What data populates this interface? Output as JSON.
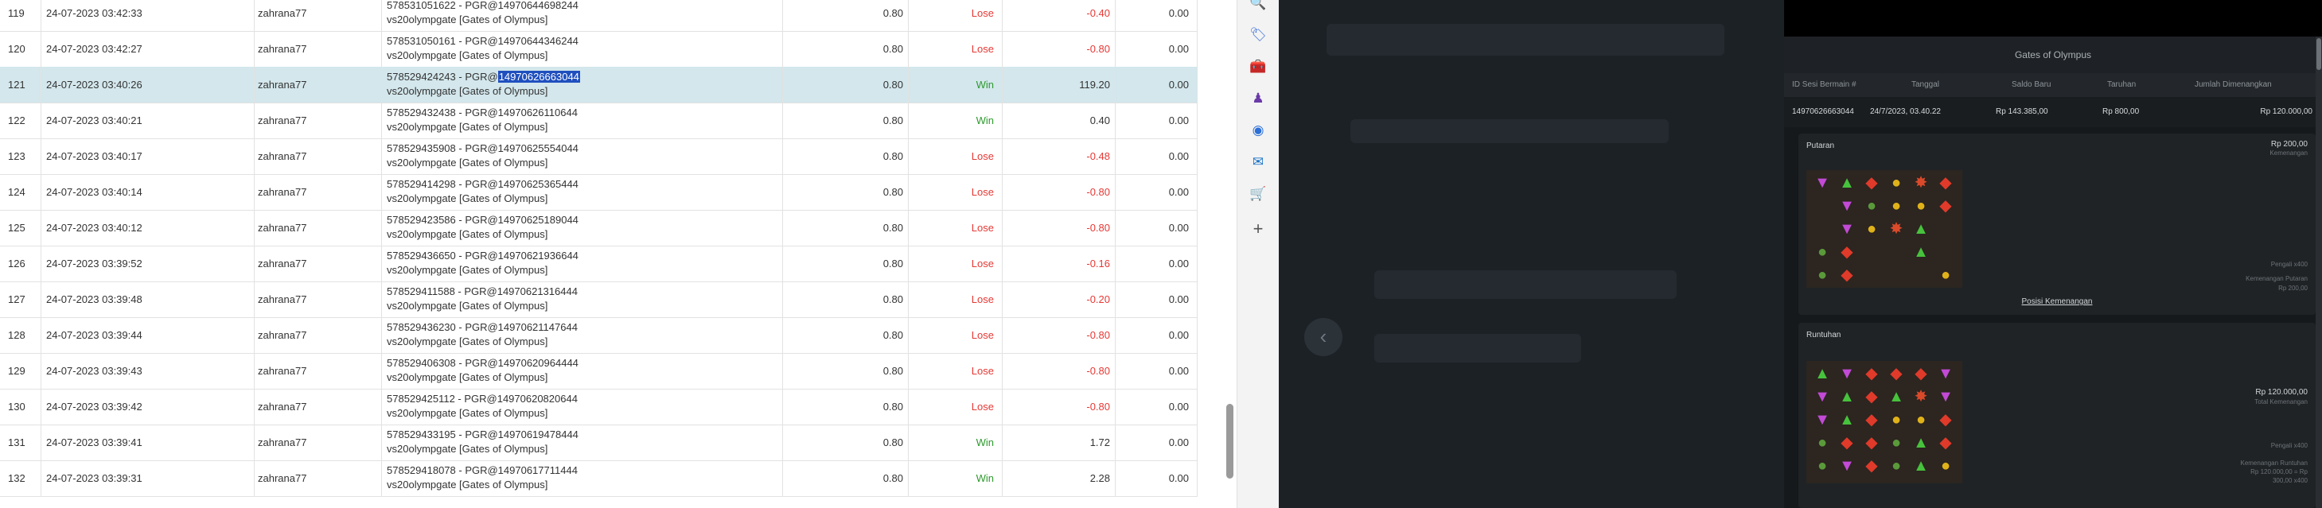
{
  "table": {
    "rows": [
      {
        "num": "119",
        "date": "24-07-2023 03:42:33",
        "user": "zahrana77",
        "id": "578531051622 - PGR@14970644698244",
        "game": "vs20olympgate [Gates of Olympus]",
        "bet": "0.80",
        "result": "Lose",
        "win": "-0.40",
        "jackpot": "0.00"
      },
      {
        "num": "120",
        "date": "24-07-2023 03:42:27",
        "user": "zahrana77",
        "id": "578531050161 - PGR@14970644346244",
        "game": "vs20olympgate [Gates of Olympus]",
        "bet": "0.80",
        "result": "Lose",
        "win": "-0.80",
        "jackpot": "0.00"
      },
      {
        "num": "121",
        "date": "24-07-2023 03:40:26",
        "user": "zahrana77",
        "id_prefix": "578529424243 - PGR@",
        "id_highlight": "14970626663044",
        "game": "vs20olympgate [Gates of Olympus]",
        "bet": "0.80",
        "result": "Win",
        "win": "119.20",
        "jackpot": "0.00",
        "selected": true
      },
      {
        "num": "122",
        "date": "24-07-2023 03:40:21",
        "user": "zahrana77",
        "id": "578529432438 - PGR@14970626110644",
        "game": "vs20olympgate [Gates of Olympus]",
        "bet": "0.80",
        "result": "Win",
        "win": "0.40",
        "jackpot": "0.00"
      },
      {
        "num": "123",
        "date": "24-07-2023 03:40:17",
        "user": "zahrana77",
        "id": "578529435908 - PGR@14970625554044",
        "game": "vs20olympgate [Gates of Olympus]",
        "bet": "0.80",
        "result": "Lose",
        "win": "-0.48",
        "jackpot": "0.00"
      },
      {
        "num": "124",
        "date": "24-07-2023 03:40:14",
        "user": "zahrana77",
        "id": "578529414298 - PGR@14970625365444",
        "game": "vs20olympgate [Gates of Olympus]",
        "bet": "0.80",
        "result": "Lose",
        "win": "-0.80",
        "jackpot": "0.00"
      },
      {
        "num": "125",
        "date": "24-07-2023 03:40:12",
        "user": "zahrana77",
        "id": "578529423586 - PGR@14970625189044",
        "game": "vs20olympgate [Gates of Olympus]",
        "bet": "0.80",
        "result": "Lose",
        "win": "-0.80",
        "jackpot": "0.00"
      },
      {
        "num": "126",
        "date": "24-07-2023 03:39:52",
        "user": "zahrana77",
        "id": "578529436650 - PGR@14970621936644",
        "game": "vs20olympgate [Gates of Olympus]",
        "bet": "0.80",
        "result": "Lose",
        "win": "-0.16",
        "jackpot": "0.00"
      },
      {
        "num": "127",
        "date": "24-07-2023 03:39:48",
        "user": "zahrana77",
        "id": "578529411588 - PGR@14970621316444",
        "game": "vs20olympgate [Gates of Olympus]",
        "bet": "0.80",
        "result": "Lose",
        "win": "-0.20",
        "jackpot": "0.00"
      },
      {
        "num": "128",
        "date": "24-07-2023 03:39:44",
        "user": "zahrana77",
        "id": "578529436230 - PGR@14970621147644",
        "game": "vs20olympgate [Gates of Olympus]",
        "bet": "0.80",
        "result": "Lose",
        "win": "-0.80",
        "jackpot": "0.00"
      },
      {
        "num": "129",
        "date": "24-07-2023 03:39:43",
        "user": "zahrana77",
        "id": "578529406308 - PGR@14970620964444",
        "game": "vs20olympgate [Gates of Olympus]",
        "bet": "0.80",
        "result": "Lose",
        "win": "-0.80",
        "jackpot": "0.00"
      },
      {
        "num": "130",
        "date": "24-07-2023 03:39:42",
        "user": "zahrana77",
        "id": "578529425112 - PGR@14970620820644",
        "game": "vs20olympgate [Gates of Olympus]",
        "bet": "0.80",
        "result": "Lose",
        "win": "-0.80",
        "jackpot": "0.00"
      },
      {
        "num": "131",
        "date": "24-07-2023 03:39:41",
        "user": "zahrana77",
        "id": "578529433195 - PGR@14970619478444",
        "game": "vs20olympgate [Gates of Olympus]",
        "bet": "0.80",
        "result": "Win",
        "win": "1.72",
        "jackpot": "0.00"
      },
      {
        "num": "132",
        "date": "24-07-2023 03:39:31",
        "user": "zahrana77",
        "id": "578529418078 - PGR@14970617711444",
        "game": "vs20olympgate [Gates of Olympus]",
        "bet": "0.80",
        "result": "Win",
        "win": "2.28",
        "jackpot": "0.00"
      }
    ]
  },
  "side_icons": [
    "search-icon",
    "tag-icon",
    "toolbox-icon",
    "chess-icon",
    "chrome-icon",
    "outlook-icon",
    "shopping-icon",
    "plus-icon"
  ],
  "popup": {
    "title": "Gates of Olympus",
    "headers": {
      "id": "ID Sesi Bermain #",
      "date": "Tanggal",
      "balance": "Saldo Baru",
      "bet": "Taruhan",
      "win": "Jumlah Dimenangkan"
    },
    "values": {
      "id": "14970626663044",
      "date": "24/7/2023, 03.40.22",
      "balance": "Rp 143.385,00",
      "bet": "Rp 800,00",
      "win": "Rp 120.000,00"
    },
    "spin": {
      "title": "Putaran",
      "amount": "Rp 200,00",
      "amount_sub": "Kemenangan",
      "mult_label": "Pengali x400",
      "win_label": "Kemenangan Putaran",
      "win_value": "Rp 200,00",
      "link": "Posisi Kemenangan"
    },
    "tumble": {
      "title": "Runtuhan",
      "amount": "Rp 120.000,00",
      "amount_sub": "Total Kemenangan",
      "mult_label": "Pengali x400",
      "win_label": "Kemenangan Runtuhan",
      "win_value1": "Rp 120.000,00 = Rp",
      "win_value2": "300,00 x400"
    }
  },
  "colors": {
    "lose": "#e53935",
    "win": "#2e9a2e",
    "selected_row": "#d3e7ec",
    "highlight": "#1f4fbf"
  }
}
